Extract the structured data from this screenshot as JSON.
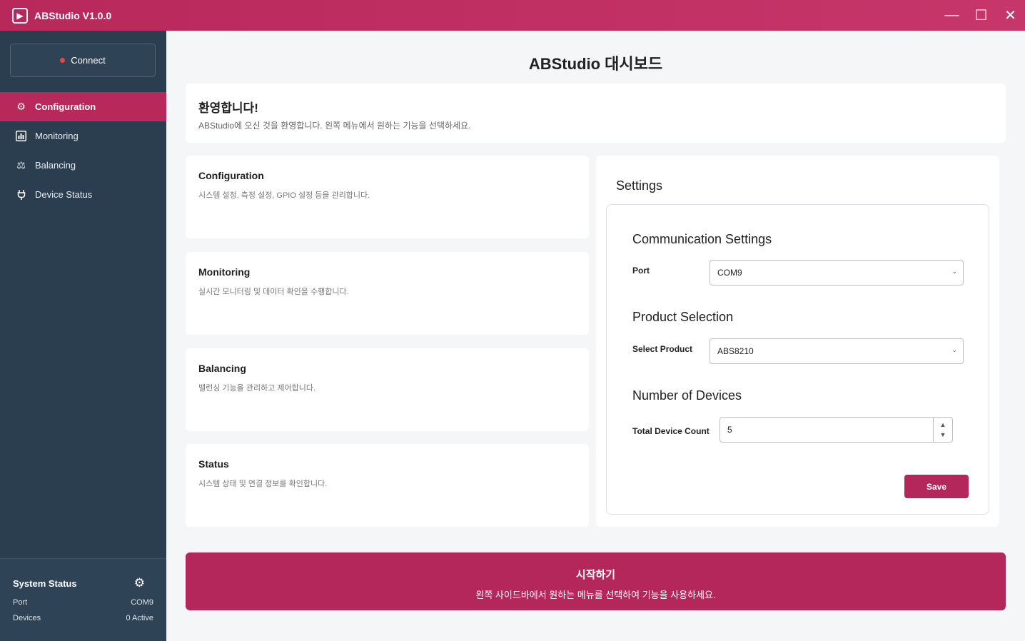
{
  "window": {
    "title": "ABStudio V1.0.0",
    "app_icon": "app-logo-icon",
    "controls": {
      "minimize": "—",
      "maximize": "☐",
      "close": "✕"
    }
  },
  "sidebar": {
    "connect_label": "Connect",
    "status_dot_color": "#e84545",
    "items": [
      {
        "label": "Configuration",
        "icon": "gear-icon",
        "active": true
      },
      {
        "label": "Monitoring",
        "icon": "chart-icon",
        "active": false
      },
      {
        "label": "Balancing",
        "icon": "balance-icon",
        "active": false
      },
      {
        "label": "Device Status",
        "icon": "plug-icon",
        "active": false
      }
    ],
    "system_status": {
      "title": "System Status",
      "rows": [
        {
          "label": "Port",
          "value": "COM9"
        },
        {
          "label": "Devices",
          "value": "0 Active"
        }
      ]
    }
  },
  "main": {
    "title": "ABStudio 대시보드",
    "welcome": {
      "heading": "환영합니다!",
      "text": "ABStudio에 오신 것을 환영합니다. 왼쪽 메뉴에서 원하는 기능을 선택하세요."
    },
    "features": [
      {
        "title": "Configuration",
        "desc": "시스템 설정, 측정 설정, GPIO 설정 등을 관리합니다."
      },
      {
        "title": "Monitoring",
        "desc": "실시간 모니터링 및 데이터 확인을 수행합니다."
      },
      {
        "title": "Balancing",
        "desc": "밸런싱 기능을 관리하고 제어합니다."
      },
      {
        "title": "Status",
        "desc": "시스템 상태 및 연결 정보를 확인합니다."
      }
    ],
    "settings": {
      "title": "Settings",
      "communication": {
        "title": "Communication Settings",
        "port_label": "Port",
        "port_value": "COM9"
      },
      "product": {
        "title": "Product Selection",
        "label": "Select Product",
        "value": "ABS8210"
      },
      "devices": {
        "title": "Number of Devices",
        "label": "Total Device Count",
        "value": "5"
      },
      "save_label": "Save"
    },
    "banner": {
      "title": "시작하기",
      "text": "왼쪽 사이드바에서 원하는 메뉴를 선택하여 기능을 사용하세요."
    }
  },
  "colors": {
    "accent": "#b3275a",
    "sidebar": "#2b3e50"
  }
}
